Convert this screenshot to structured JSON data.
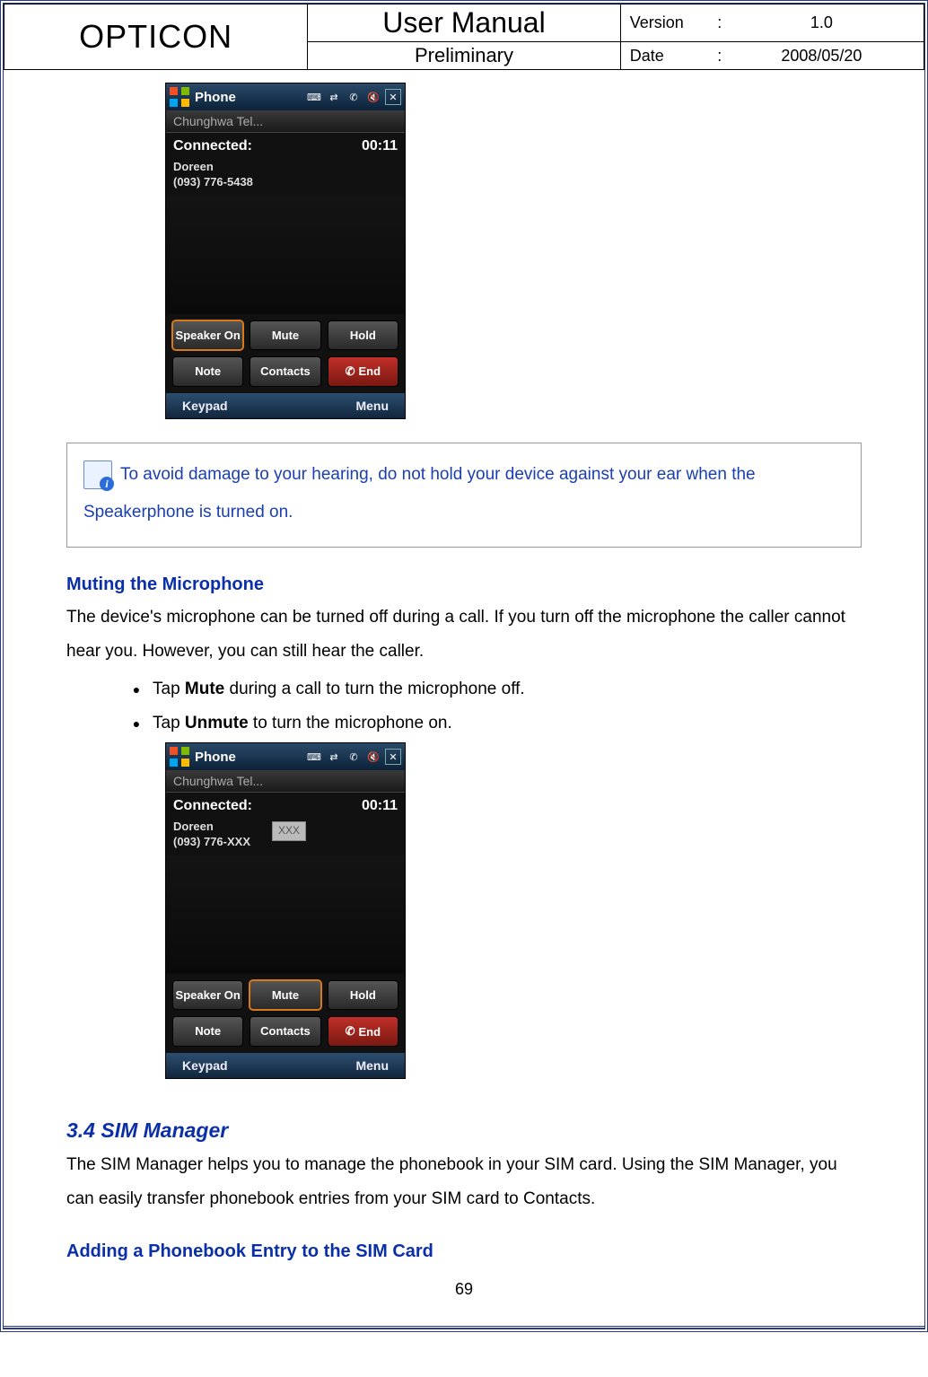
{
  "header": {
    "brand": "OPTICON",
    "title": "User Manual",
    "subtitle": "Preliminary",
    "version_label": "Version",
    "version_value": "1.0",
    "date_label": "Date",
    "date_value": "2008/05/20"
  },
  "phone1": {
    "titlebar": "Phone",
    "carrier": "Chunghwa Tel...",
    "status_label": "Connected:",
    "duration": "00:11",
    "caller_name": "Doreen",
    "caller_number": "(093) 776-5438",
    "btn_speaker": "Speaker On",
    "btn_mute": "Mute",
    "btn_hold": "Hold",
    "btn_note": "Note",
    "btn_contacts": "Contacts",
    "btn_end": "End",
    "soft_left": "Keypad",
    "soft_right": "Menu"
  },
  "phone2": {
    "titlebar": "Phone",
    "carrier": "Chunghwa Tel...",
    "status_label": "Connected:",
    "duration": "00:11",
    "caller_name": "Doreen",
    "caller_number": "(093) 776-XXX",
    "mute_badge": "XXX",
    "btn_speaker": "Speaker On",
    "btn_mute": "Mute",
    "btn_hold": "Hold",
    "btn_note": "Note",
    "btn_contacts": "Contacts",
    "btn_end": "End",
    "soft_left": "Keypad",
    "soft_right": "Menu"
  },
  "note": {
    "text_a": "To avoid damage to your hearing, do not hold your device against your ear when the",
    "text_b": "Speakerphone is turned on."
  },
  "muting": {
    "heading": "Muting the Microphone",
    "para": "The device's microphone can be turned off during a call. If you turn off the microphone the caller cannot hear you. However, you can still hear the caller.",
    "bullet1_pre": "Tap ",
    "bullet1_bold": "Mute",
    "bullet1_post": " during a call to turn the microphone off.",
    "bullet2_pre": "Tap ",
    "bullet2_bold": "Unmute",
    "bullet2_post": " to turn the microphone on."
  },
  "sim": {
    "heading": "3.4 SIM Manager",
    "para": "The SIM Manager helps you to manage the phonebook in your SIM card. Using the SIM Manager, you can easily transfer phonebook entries from your SIM card to Contacts.",
    "sub": "Adding a Phonebook Entry to the SIM Card"
  },
  "page_number": "69"
}
